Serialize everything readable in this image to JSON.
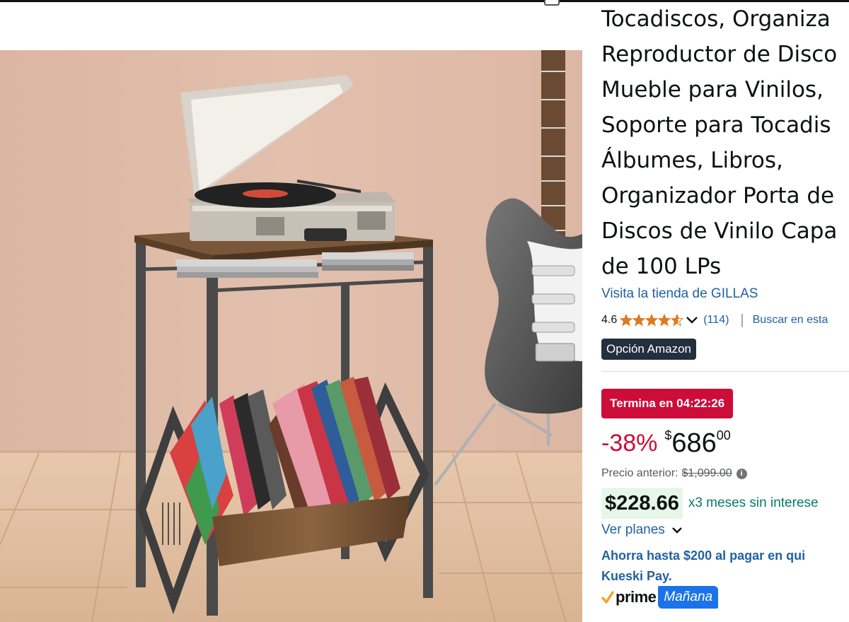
{
  "product": {
    "title_lines": [
      "Tocadiscos, Organiza",
      "Reproductor de Disco",
      "Mueble para Vinilos,",
      "Soporte para Tocadis",
      "Álbumes, Libros,",
      "Organizador Porta de",
      "Discos de Vinilo Capa",
      "de 100 LPs"
    ],
    "store_link": "Visita la tienda de GILLAS",
    "rating": "4.6",
    "rating_stars": 4.6,
    "rating_count": "(114)",
    "search_link": "Buscar en esta",
    "choice_badge": "Opción Amazon",
    "image_alt_icon": "product-photo"
  },
  "pricing": {
    "deal_badge": "Termina en 04:22:26",
    "discount": "-38%",
    "currency_symbol": "$",
    "price_whole": "686",
    "price_fraction": "00",
    "previous_label": "Precio anterior:",
    "previous_price": "$1,099.00",
    "installment_amount": "$228.66",
    "installment_text": "x3 meses sin interese",
    "plans_link": "Ver planes",
    "promo_line1": "Ahorra hasta $200 al pagar en qui",
    "promo_line2": "Kueski Pay."
  },
  "delivery": {
    "prime_label": "prime",
    "day_label": "Mañana"
  },
  "colors": {
    "link": "#2162a1",
    "deal": "#cc0c39",
    "installment_text": "#067d62",
    "star": "#de7921",
    "badge_dark": "#232f3e",
    "prime_blue": "#1a73e8"
  }
}
